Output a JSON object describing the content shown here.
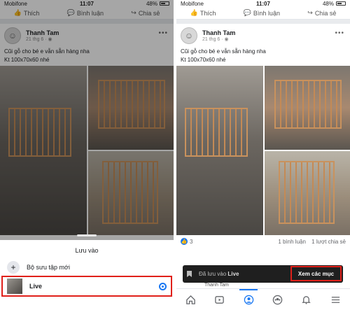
{
  "status": {
    "carrier": "Mobifone",
    "time": "11:07",
    "battery": "48%"
  },
  "top_actions": {
    "like": "Thích",
    "comment": "Bình luận",
    "share": "Chia sẻ"
  },
  "post": {
    "author": "Thanh Tam",
    "date": "21 thg 6 ·",
    "more": "•••",
    "caption_line1": "Cũi gỗ cho bé e vẫn sẵn hàng nha",
    "caption_line2": "Kt 100x70x60 nhé"
  },
  "save_sheet": {
    "title": "Lưu vào",
    "new_collection": "Bộ sưu tập mới",
    "collection_live": "Live"
  },
  "reactions": {
    "count": "3",
    "comments": "1 bình luận",
    "shares": "1 lượt chia sẻ"
  },
  "toast": {
    "message": "Đã lưu vào Live",
    "message_prefix": "Đã lưu vào",
    "message_target": "Live",
    "action": "Xem các mục"
  },
  "peek_author": "Thanh Tam",
  "tabs": [
    "home-icon",
    "video-icon",
    "profile-icon",
    "groups-icon",
    "notifications-icon",
    "menu-icon"
  ],
  "colors": {
    "accent": "#1877f2",
    "highlight_border": "#e0201a",
    "toast_bg": "#1f1f1f"
  }
}
